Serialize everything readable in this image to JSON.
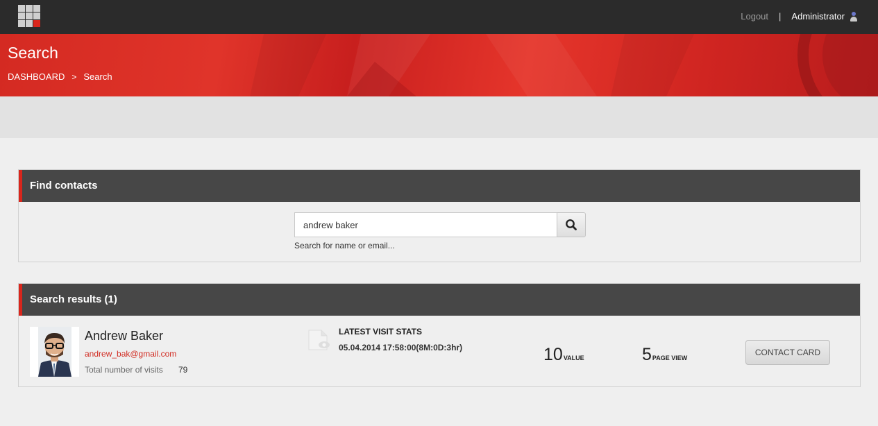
{
  "topbar": {
    "logo_icon": "grid-logo-icon",
    "logout_label": "Logout",
    "separator": "|",
    "user_name": "Administrator",
    "user_icon": "user-icon"
  },
  "header": {
    "title": "Search",
    "breadcrumb": [
      "DASHBOARD",
      "Search"
    ],
    "breadcrumb_separator": ">"
  },
  "find_panel": {
    "title": "Find contacts",
    "search_value": "andrew baker",
    "search_hint": "Search for name or email...",
    "search_icon": "search-icon"
  },
  "results_panel": {
    "title": "Search results (1)",
    "result": {
      "name": "Andrew Baker",
      "email": "andrew_bak@gmail.com",
      "visits_label": "Total number of visits",
      "visits_count": "79",
      "stats_title": "LATEST VISIT STATS",
      "stats_date": "05.04.2014 17:58:00(8M:0D:3hr)",
      "value_num": "10",
      "value_label": "VALUE",
      "pageview_num": "5",
      "pageview_label": "PAGE VIEW",
      "contact_card_label": "CONTACT CARD"
    }
  },
  "colors": {
    "accent": "#d9261c",
    "topbar": "#2b2b2b",
    "panel_header": "#474747",
    "background": "#efefef"
  }
}
